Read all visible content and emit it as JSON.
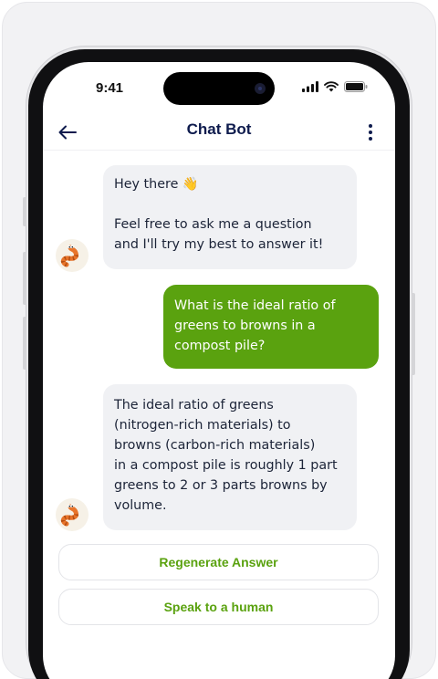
{
  "status_bar": {
    "time": "9:41",
    "icons": [
      "signal-icon",
      "wifi-icon",
      "battery-icon"
    ]
  },
  "header": {
    "title": "Chat Bot",
    "back_icon": "arrow-left-icon",
    "menu_icon": "kebab-menu-icon"
  },
  "messages": [
    {
      "sender": "bot",
      "greeting": "Hey there 👋",
      "text": "Feel free to ask me a question\nand I'll try my best to answer it!"
    },
    {
      "sender": "user",
      "text": "What is the ideal ratio of\ngreens to browns in a\ncompost pile?"
    },
    {
      "sender": "bot",
      "text": "The ideal ratio of greens\n(nitrogen-rich materials) to\nbrowns (carbon-rich materials)\nin a compost pile is roughly 1 part\ngreens to 2 or 3 parts browns by\nvolume."
    }
  ],
  "actions": {
    "regenerate_label": "Regenerate Answer",
    "human_label": "Speak to a human"
  },
  "colors": {
    "accent": "#5aa20f",
    "title": "#0e1b4d",
    "bot_bubble": "#f0f1f4"
  },
  "avatar_icon": "worm-mascot-icon"
}
